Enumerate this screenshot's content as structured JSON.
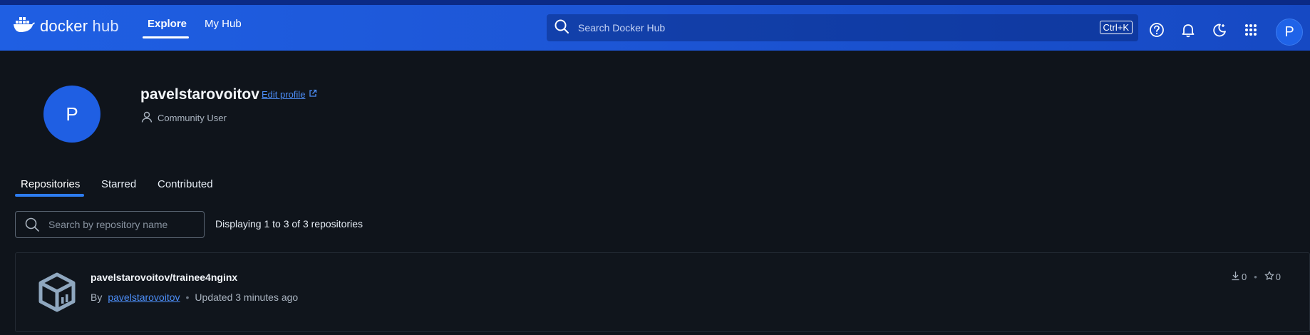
{
  "header": {
    "logo_word1": "docker",
    "logo_word2": "hub",
    "nav": [
      {
        "label": "Explore"
      },
      {
        "label": "My Hub"
      }
    ],
    "search_placeholder": "Search Docker Hub",
    "search_shortcut": "Ctrl+K",
    "avatar_initial": "P",
    "icons": [
      "help-icon",
      "bell-icon",
      "theme-toggle-icon",
      "apps-grid-icon"
    ]
  },
  "profile": {
    "avatar_initial": "P",
    "username": "pavelstarovoitov",
    "edit_label": "Edit profile",
    "role": "Community User"
  },
  "tabs": [
    {
      "label": "Repositories"
    },
    {
      "label": "Starred"
    },
    {
      "label": "Contributed"
    }
  ],
  "repo_search": {
    "placeholder": "Search by repository name",
    "summary": "Displaying 1 to 3 of 3 repositories"
  },
  "repositories": [
    {
      "name": "pavelstarovoitov/trainee4nginx",
      "by_label": "By",
      "owner": "pavelstarovoitov",
      "updated": "Updated 3 minutes ago",
      "pulls": "0",
      "stars": "0"
    }
  ],
  "colors": {
    "header_blue": "#1f5fe3",
    "accent_blue": "#2d7cf0",
    "link_blue": "#4c8df6",
    "background": "#0f141b"
  }
}
